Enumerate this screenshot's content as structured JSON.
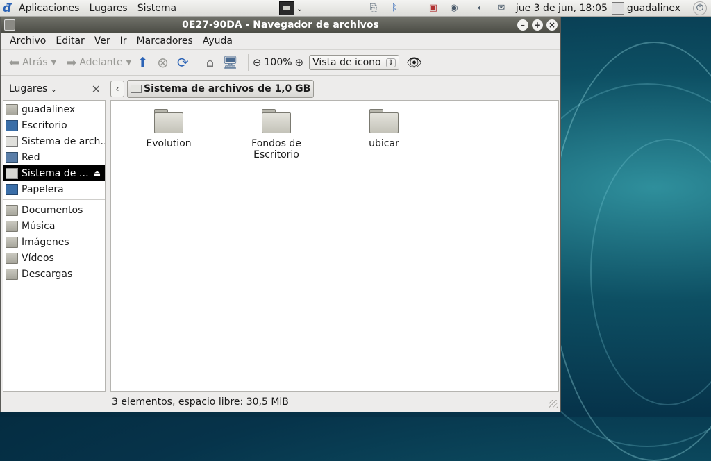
{
  "top_panel": {
    "menus": [
      "Aplicaciones",
      "Lugares",
      "Sistema"
    ],
    "datetime": "jue  3 de jun, 18:05",
    "user": "guadalinex"
  },
  "window": {
    "title": "0E27-90DA - Navegador de archivos",
    "menubar": [
      "Archivo",
      "Editar",
      "Ver",
      "Ir",
      "Marcadores",
      "Ayuda"
    ],
    "toolbar": {
      "back": "Atrás",
      "forward": "Adelante",
      "zoom": "100%",
      "view_mode": "Vista de icono"
    },
    "location": {
      "sidebar_title": "Lugares",
      "path": "Sistema de archivos de 1,0 GB"
    },
    "sidebar": {
      "places": [
        {
          "label": "guadalinex",
          "icon": "home-folder-icon"
        },
        {
          "label": "Escritorio",
          "icon": "desktop-icon"
        },
        {
          "label": "Sistema de arch…",
          "icon": "filesystem-icon"
        },
        {
          "label": "Red",
          "icon": "network-icon"
        },
        {
          "label": "Sistema de …",
          "icon": "removable-drive-icon",
          "selected": true
        },
        {
          "label": "Papelera",
          "icon": "trash-icon"
        }
      ],
      "bookmarks": [
        {
          "label": "Documentos",
          "icon": "folder-icon"
        },
        {
          "label": "Música",
          "icon": "folder-icon"
        },
        {
          "label": "Imágenes",
          "icon": "folder-icon"
        },
        {
          "label": "Vídeos",
          "icon": "folder-icon"
        },
        {
          "label": "Descargas",
          "icon": "folder-icon"
        }
      ]
    },
    "files": [
      "Evolution",
      "Fondos de Escritorio",
      "ubicar"
    ],
    "status": "3 elementos, espacio libre: 30,5 MiB"
  }
}
